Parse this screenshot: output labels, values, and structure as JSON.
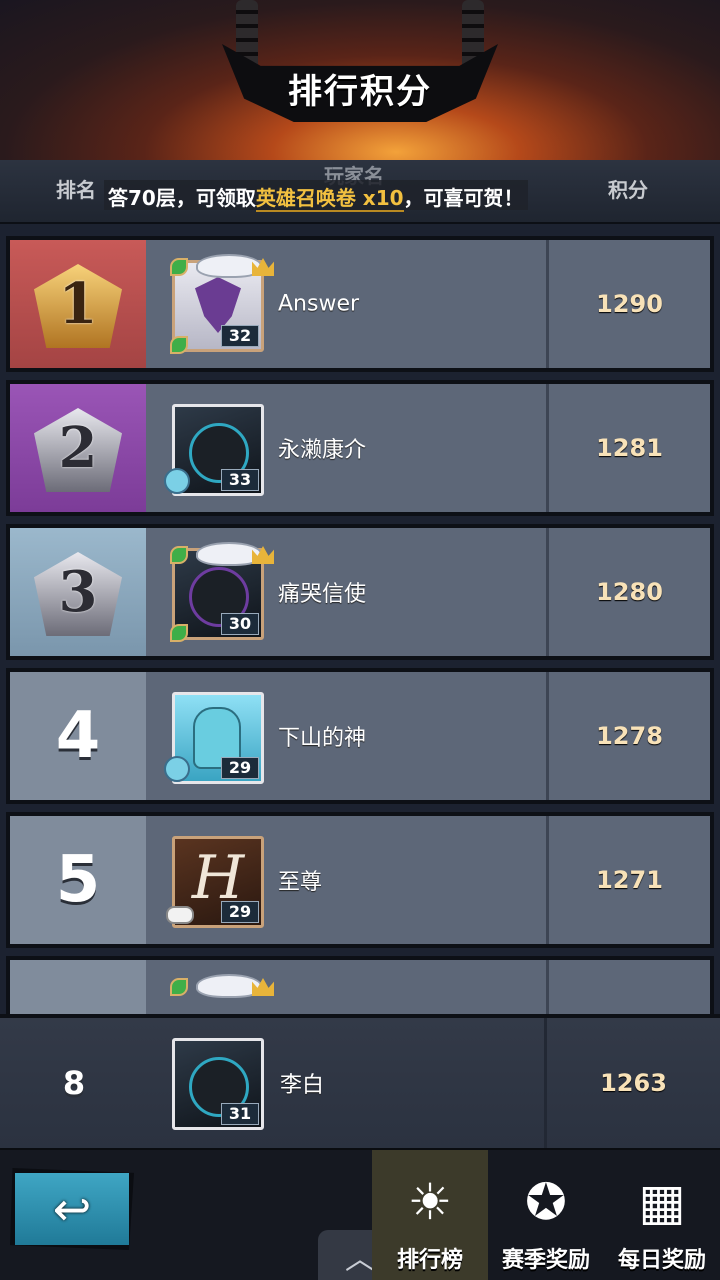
{
  "header": {
    "title": "排行积分"
  },
  "columns": {
    "rank": "排名",
    "player": "玩家名",
    "score": "积分"
  },
  "marquee": {
    "prefix": "答70层，可领取",
    "highlight": "英雄召唤卷 x10",
    "suffix": "，可喜可贺！"
  },
  "rows": [
    {
      "rank": "1",
      "name": "Answer",
      "level": "32",
      "score": "1290",
      "avatar": "winged-emblem-avatar"
    },
    {
      "rank": "2",
      "name": "永濑康介",
      "level": "33",
      "score": "1281",
      "avatar": "dark-hero-avatar"
    },
    {
      "rank": "3",
      "name": "痛哭信使",
      "level": "30",
      "score": "1280",
      "avatar": "shadow-hero-avatar"
    },
    {
      "rank": "4",
      "name": "下山的神",
      "level": "29",
      "score": "1278",
      "avatar": "dino-avatar"
    },
    {
      "rank": "5",
      "name": "至尊",
      "level": "29",
      "score": "1271",
      "avatar": "letter-h-avatar"
    }
  ],
  "my_row": {
    "rank": "8",
    "name": "李白",
    "level": "31",
    "score": "1263",
    "avatar": "dark-hero-avatar"
  },
  "bottom": {
    "tabs": [
      {
        "label": "排行榜",
        "icon": "sun-icon",
        "active": true
      },
      {
        "label": "赛季奖励",
        "icon": "flame-emblem-icon",
        "active": false
      },
      {
        "label": "每日奖励",
        "icon": "gift-icon",
        "active": false
      }
    ],
    "back_icon": "back-arrow-icon",
    "handle_icon": "chevron-up-icon"
  },
  "colors": {
    "gold": "#f2c040",
    "score": "#f8e2b8",
    "rank1": "#b84e4c",
    "rank2": "#8a48a8",
    "rank3": "#8aa8bc"
  }
}
